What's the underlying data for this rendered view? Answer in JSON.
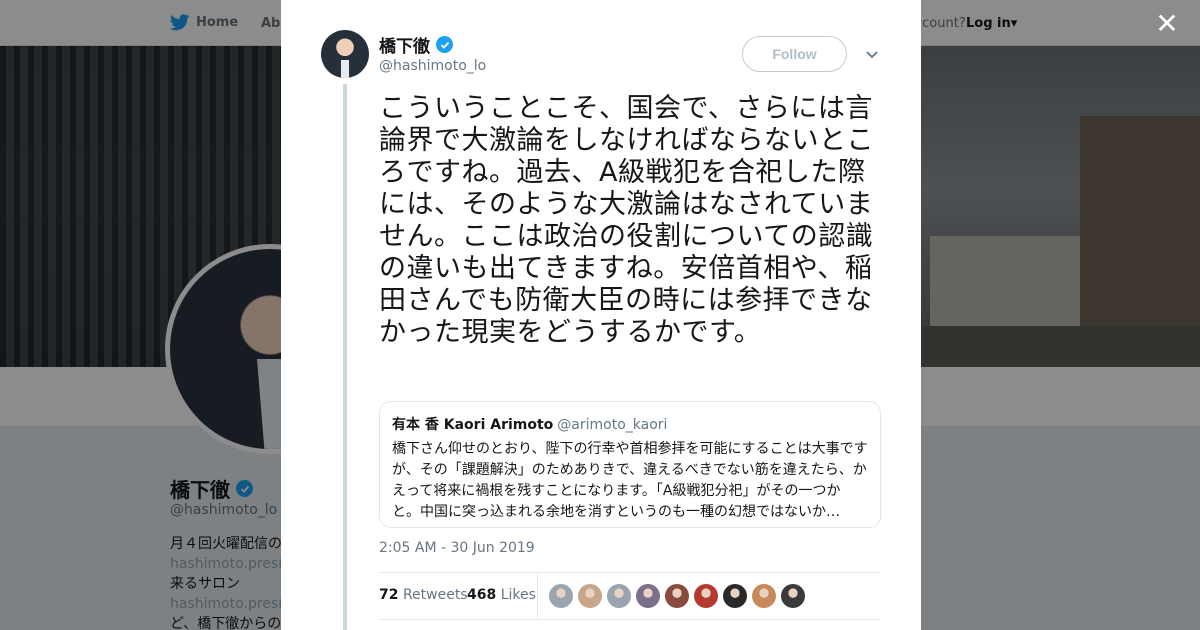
{
  "nav": {
    "home_label": "Home",
    "about_label": "Abo",
    "account_label": "ccount?",
    "login_label": "Log in"
  },
  "profile_bg": {
    "name": "橋下徹",
    "handle": "@hashimoto_lo",
    "bio_line1": "月４回火曜配信の",
    "bio_link1": "hashimoto.preside",
    "bio_line2": "来るサロン",
    "bio_link2": "hashimoto.preside",
    "bio_line3": "ど、橋下徹からの"
  },
  "tweet": {
    "author_name": "橋下徹",
    "author_handle": "@hashimoto_lo",
    "follow_label": "Follow",
    "text": "こういうことこそ、国会で、さらには言論界で大激論をしなければならないところですね。過去、A級戦犯を合祀した際には、そのような大激論はなされていません。ここは政治の役割についての認識の違いも出てきますね。安倍首相や、稲田さんでも防衛大臣の時には参拝できなかった現実をどうするかです。",
    "timestamp": "2:05 AM - 30 Jun 2019",
    "retweets_count": "72",
    "retweets_label": "Retweets",
    "likes_count": "468",
    "likes_label": "Likes"
  },
  "quote": {
    "name": "有本 香 Kaori Arimoto",
    "handle": "@arimoto_kaori",
    "text": "橋下さん仰せのとおり、陛下の行幸や首相参拝を可能にすることは大事ですが、その「課題解決」のためありきで、違えるべきでない筋を違えたら、かえって将来に禍根を残すことになります。「A級戦犯分祀」がその一つかと。中国に突っ込まれる余地を消すというのも一種の幻想ではないか…"
  },
  "colors": {
    "accent": "#1da1f2",
    "text": "#14171a",
    "muted": "#657786"
  },
  "liker_avatars": [
    "#9aa5b0",
    "#c9a58a",
    "#9aa5b0",
    "#7a6f8c",
    "#8a4a3c",
    "#b23a2e",
    "#2a2a2a",
    "#c98a5a",
    "#3a3a3a"
  ]
}
